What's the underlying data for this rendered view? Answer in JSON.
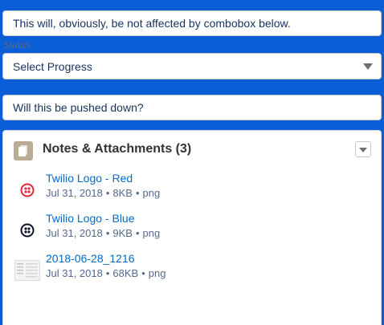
{
  "top_input": {
    "value": "This will, obviously, be not affected by combobox below."
  },
  "status": {
    "label": "Status",
    "selected": "Select Progress"
  },
  "push_input": {
    "value": "Will this be pushed down?"
  },
  "card": {
    "title": "Notes & Attachments (3)",
    "icon": "file-stack-icon",
    "files": [
      {
        "name": "Twilio Logo - Red",
        "date": "Jul 31, 2018",
        "size": "8KB",
        "type": "png",
        "thumb": "twilio-red-logo"
      },
      {
        "name": "Twilio Logo - Blue",
        "date": "Jul 31, 2018",
        "size": "9KB",
        "type": "png",
        "thumb": "twilio-dark-logo"
      },
      {
        "name": "2018-06-28_1216",
        "date": "Jul 31, 2018",
        "size": "68KB",
        "type": "png",
        "thumb": "screenshot-thumbnail"
      }
    ]
  },
  "colors": {
    "background": "#0a5fd6",
    "link": "#006dcc",
    "twilio_red": "#e7263a",
    "twilio_dark": "#0d122b",
    "card_icon_bg": "#baac93"
  }
}
